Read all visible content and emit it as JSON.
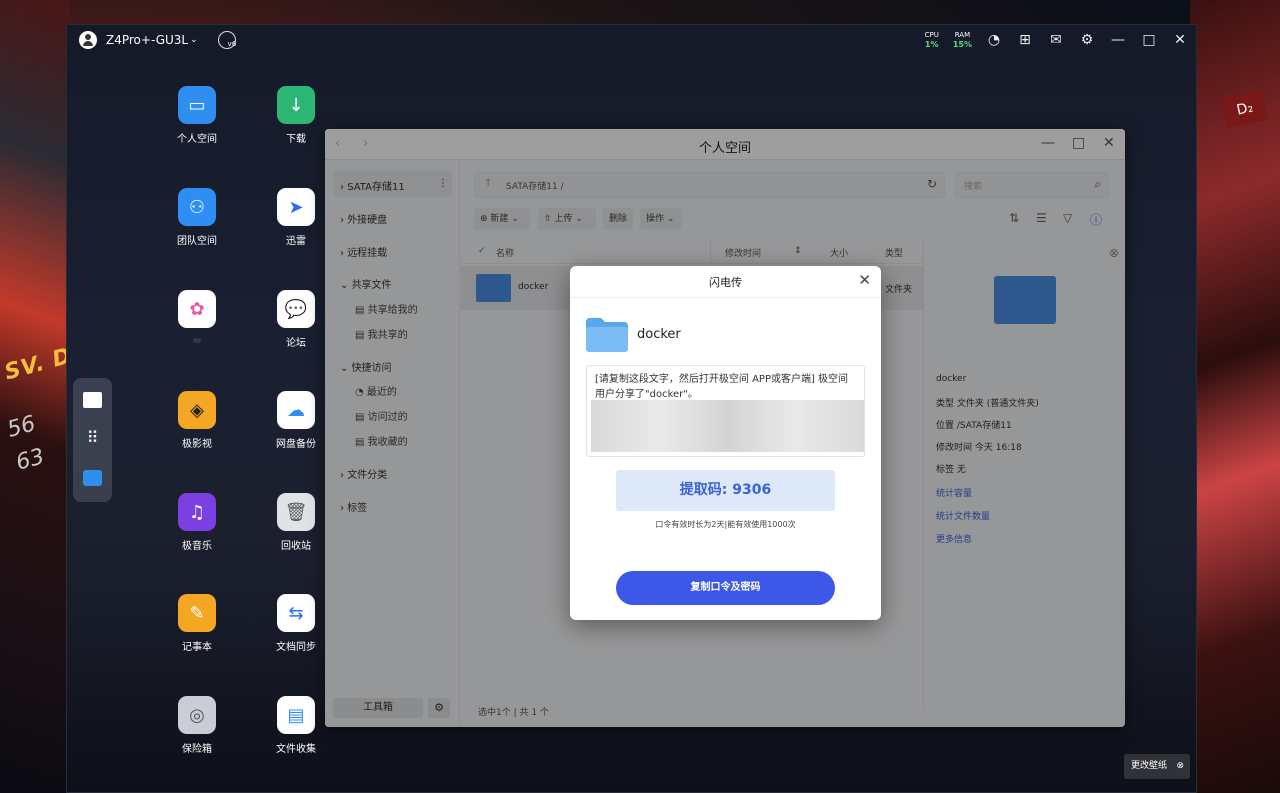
{
  "topbar": {
    "device_name": "Z4Pro+-GU3L",
    "cpu_label": "CPU",
    "cpu_value": "1%",
    "ram_label": "RAM",
    "ram_value": "15%"
  },
  "apps": [
    {
      "label": "个人空间",
      "icon": "folder-icon",
      "color": "#2f8ff0"
    },
    {
      "label": "下载",
      "icon": "download-icon",
      "color": "#2bb673"
    },
    {
      "label": "团队空间",
      "icon": "team-icon",
      "color": "#2d8ef5"
    },
    {
      "label": "迅雷",
      "icon": "thunder-icon",
      "color": "#ffffff"
    },
    {
      "label": "相册",
      "icon": "photos-icon",
      "color": "#ffffff"
    },
    {
      "label": "论坛",
      "icon": "forum-icon",
      "color": "#ffffff"
    },
    {
      "label": "极影视",
      "icon": "video-icon",
      "color": "#f5a623"
    },
    {
      "label": "网盘备份",
      "icon": "cloud-backup-icon",
      "color": "#ffffff"
    },
    {
      "label": "极音乐",
      "icon": "music-icon",
      "color": "#7b3fe4"
    },
    {
      "label": "回收站",
      "icon": "trash-icon",
      "color": "#dfe3e8"
    },
    {
      "label": "记事本",
      "icon": "notepad-icon",
      "color": "#f5a623"
    },
    {
      "label": "文档同步",
      "icon": "sync-icon",
      "color": "#ffffff"
    },
    {
      "label": "保险箱",
      "icon": "safe-icon",
      "color": "#c9ced6"
    },
    {
      "label": "文件收集",
      "icon": "collect-icon",
      "color": "#ffffff"
    }
  ],
  "window": {
    "title": "个人空间",
    "sidebar": {
      "sata": "SATA存储11",
      "external": "外接硬盘",
      "remote": "远程挂载",
      "shared": "共享文件",
      "shared_to_me": "共享给我的",
      "my_shared": "我共享的",
      "quick": "快捷访问",
      "recent": "最近的",
      "visited": "访问过的",
      "favorites": "我收藏的",
      "category": "文件分类",
      "tags": "标签",
      "toolbox": "工具箱"
    },
    "path": "SATA存储11 /",
    "search_placeholder": "搜索",
    "toolbar": {
      "new": "新建",
      "upload": "上传",
      "delete": "删除",
      "action": "操作"
    },
    "columns": {
      "name": "名称",
      "modified": "修改时间",
      "size": "大小",
      "type": "类型"
    },
    "row": {
      "name": "docker",
      "type": "文件夹"
    },
    "detail": {
      "name": "docker",
      "type_label": "类型",
      "type_value": "文件夹 (普通文件夹)",
      "location_label": "位置",
      "location_value": "/SATA存储11",
      "mtime_label": "修改时间",
      "mtime_value": "今天 16:18",
      "tag_label": "标签",
      "tag_value": "无",
      "link1": "统计容量",
      "link2": "统计文件数量",
      "link3": "更多信息"
    },
    "status": "选中1个 | 共 1 个"
  },
  "modal": {
    "title": "闪电传",
    "file_name": "docker",
    "share_text": "[请复制这段文字，然后打开极空间 APP或客户端] 极空间用户分享了\"docker\"。",
    "code": "提取码: 9306",
    "note": "口令有效时长为2天|能有效使用1000次",
    "copy_button": "复制口令及密码"
  },
  "wallpaper_button": "更改壁纸",
  "colors": {
    "accent": "#3d58e8",
    "link": "#3a63d8",
    "code_bg": "#dde8f8"
  }
}
